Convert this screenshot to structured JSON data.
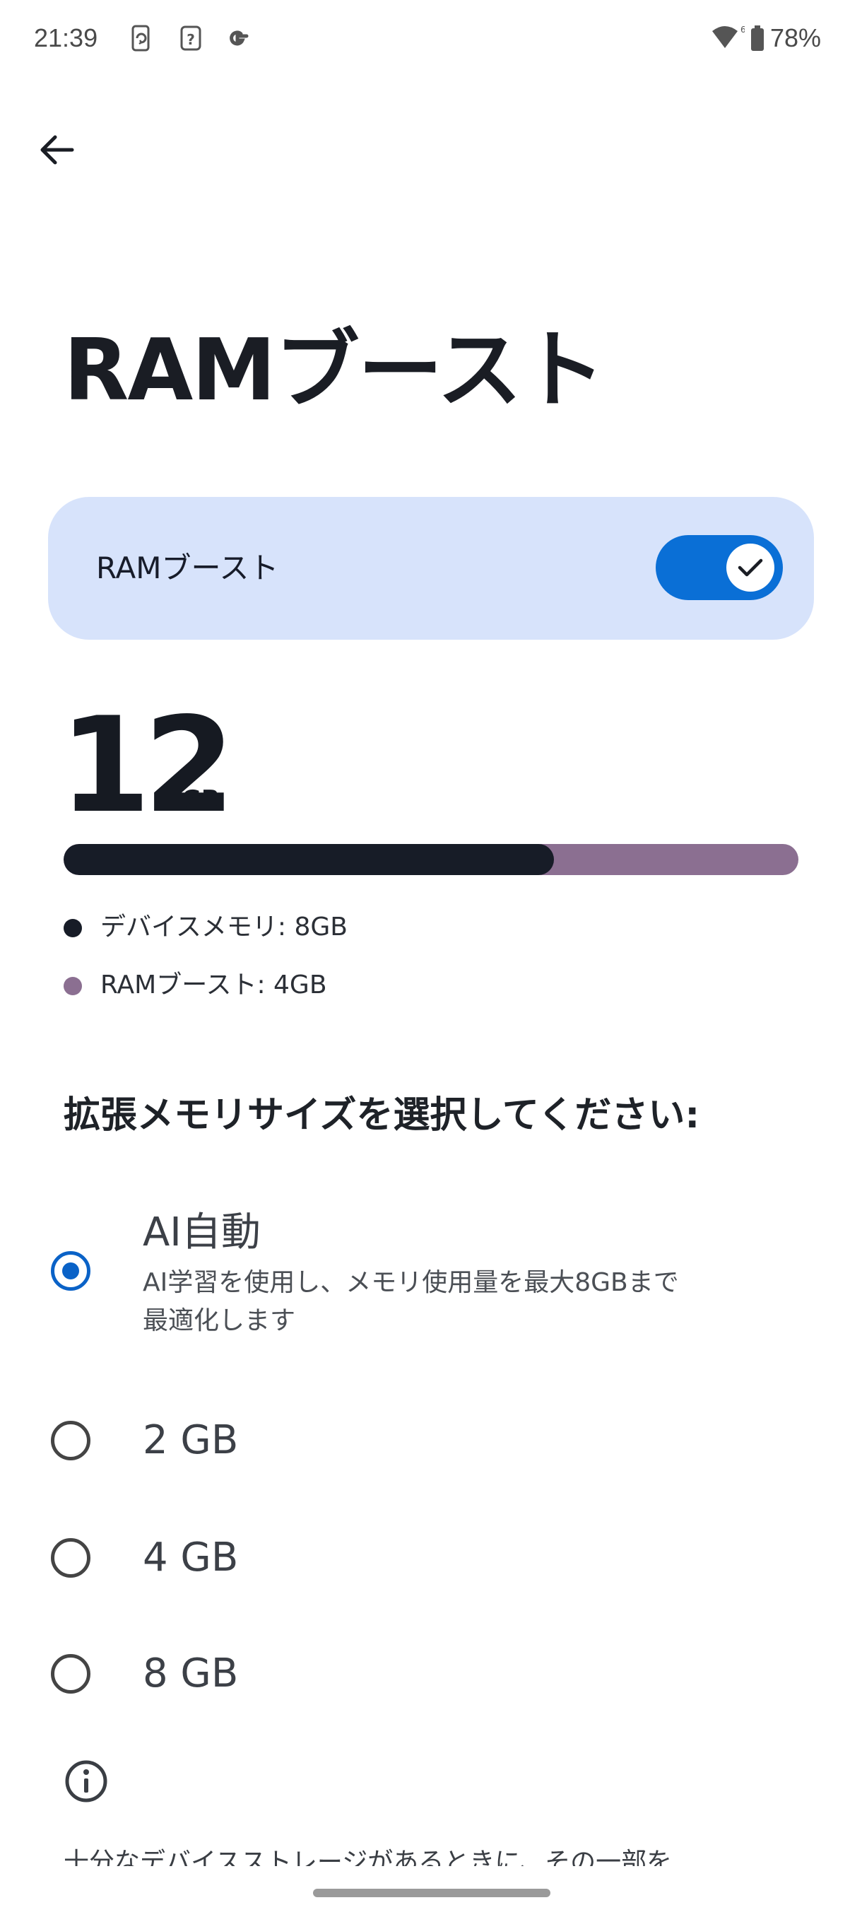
{
  "status_bar": {
    "time": "21:39",
    "battery": "78%",
    "icons": [
      "phone-sync-icon",
      "unknown-app-icon",
      "google-icon",
      "wifi-icon",
      "battery-icon"
    ]
  },
  "header": {
    "back_icon": "arrow-left-icon",
    "title": "RAMブースト"
  },
  "toggle": {
    "label": "RAMブースト",
    "on": true,
    "accent": "#0a6fd6",
    "card_color": "#d7e3fb"
  },
  "capacity": {
    "total": "12",
    "unit": "GB",
    "device_gb": 8,
    "boost_gb": 4,
    "device_fraction": 0.667,
    "device_color": "#171c27",
    "boost_color": "#8b6f91",
    "legend": [
      {
        "label": "デバイスメモリ: 8GB",
        "color": "#171c27"
      },
      {
        "label": "RAMブースト: 4GB",
        "color": "#8b6f91"
      }
    ]
  },
  "selection": {
    "heading": "拡張メモリサイズを選択してください:",
    "options": [
      {
        "title": "AI自動",
        "desc_line1": "AI学習を使用し、メモリ使用量を最大8GBまで",
        "desc_line2": "最適化します",
        "selected": true
      },
      {
        "title": "2 GB",
        "selected": false
      },
      {
        "title": "4 GB",
        "selected": false
      },
      {
        "title": "8 GB",
        "selected": false
      }
    ]
  },
  "footer": {
    "info_icon": "info-icon",
    "text": "十分なデバイスストレージがあるときに、その一部を"
  }
}
